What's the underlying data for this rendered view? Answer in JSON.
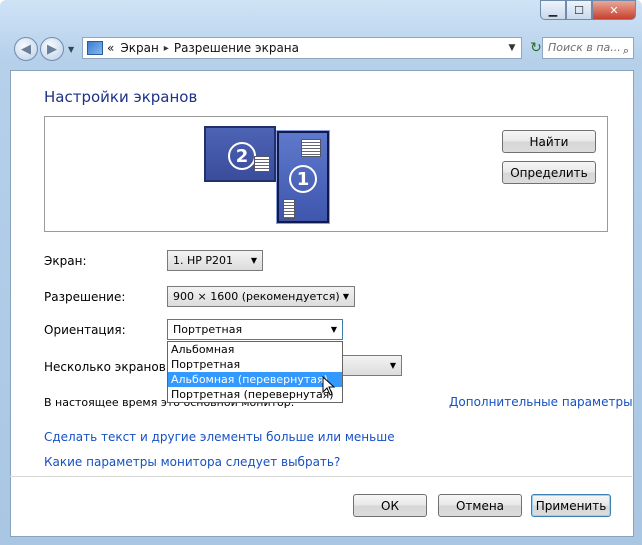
{
  "breadcrumb": {
    "prefix": "«",
    "items": [
      "Экран",
      "Разрешение экрана"
    ],
    "separator": "▸"
  },
  "search": {
    "placeholder": "Поиск в па..."
  },
  "heading": "Настройки экранов",
  "preview": {
    "monitor_2_number": "2",
    "monitor_1_number": "1",
    "detect_button": "Найти",
    "identify_button": "Определить"
  },
  "form": {
    "display_label": "Экран:",
    "display_value": "1. HP P201",
    "resolution_label": "Разрешение:",
    "resolution_value": "900 × 1600 (рекомендуется)",
    "orientation_label": "Ориентация:",
    "orientation_value": "Портретная",
    "orientation_options": [
      "Альбомная",
      "Портретная",
      "Альбомная (перевернутая)",
      "Портретная (перевернутая)"
    ],
    "orientation_highlighted_index": 2,
    "multiple_label": "Несколько экранов:",
    "current_text": "В настоящее время это основной монитор."
  },
  "links": {
    "advanced": "Дополнительные параметры",
    "text_size": "Сделать текст и другие элементы больше или меньше",
    "which_settings": "Какие параметры монитора следует выбрать?"
  },
  "buttons": {
    "ok": "ОК",
    "cancel": "Отмена",
    "apply": "Применить"
  },
  "icons": {
    "back": "back-arrow-icon",
    "forward": "forward-arrow-icon",
    "refresh": "refresh-icon",
    "search": "search-icon",
    "control_panel": "control-panel-icon"
  },
  "colors": {
    "heading": "#1e3287",
    "link": "#1551c4",
    "selection": "#3399ff"
  }
}
